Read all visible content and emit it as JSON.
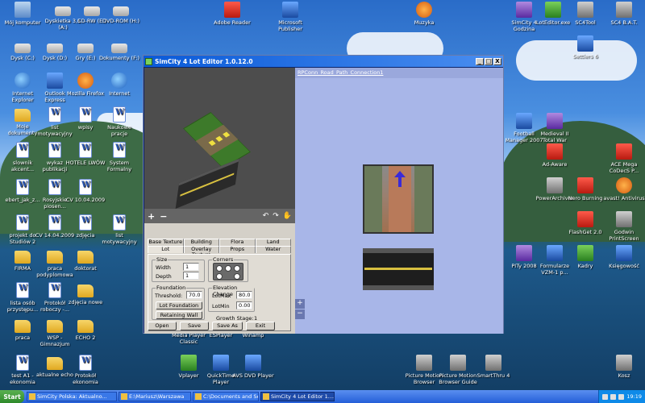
{
  "window": {
    "title": "SimCity 4 Lot Editor 1.0.12.0",
    "minimize": "_",
    "maximize": "□",
    "close": "X"
  },
  "viewport": {
    "lot_name": "RPConn_Road_Path_Connection1",
    "zoom_in": "+",
    "zoom_out": "−"
  },
  "toolstrip": {
    "add": "+",
    "remove": "−",
    "rotate_left": "↶",
    "rotate_right": "↷",
    "hand": "✋"
  },
  "tabs": {
    "row1": [
      "Base Texture",
      "Building",
      "Flora",
      "Land"
    ],
    "row2": [
      "Lot",
      "Overlay Texture",
      "Props",
      "Water"
    ],
    "active": "Lot"
  },
  "lot_tab": {
    "size_label": "Size",
    "width_label": "Width",
    "width_value": "1",
    "depth_label": "Depth",
    "depth_value": "1",
    "corners_label": "Corners",
    "foundation_label": "Foundation",
    "threshold_label": "Threshold:",
    "threshold_value": "70.0",
    "lot_foundation_button": "Lot Foundation",
    "retaining_wall_button": "Retaining Wall",
    "elevation_label": "Elevation Change",
    "lotmax_label": "LotMax",
    "lotmax_value": "80.0",
    "lotmin_label": "LotMin",
    "lotmin_value": "0.00",
    "growth_stage_label": "Growth Stage:",
    "growth_stage_value": "1"
  },
  "bottom_buttons": {
    "open": "Open",
    "save": "Save",
    "save_as": "Save As",
    "exit": "Exit"
  },
  "desktop_icons": [
    {
      "label": "Mój komputer",
      "kind": "pc"
    },
    {
      "label": "Dyskietka 3,5 (A:)",
      "kind": "drive"
    },
    {
      "label": "CD-RW (E:)",
      "kind": "drive"
    },
    {
      "label": "DVD-ROM (H:)",
      "kind": "drive"
    },
    {
      "label": "Adobe Reader",
      "kind": "red"
    },
    {
      "label": "Microsoft Publisher",
      "kind": "blue"
    },
    {
      "label": "Muzyka",
      "kind": "orange"
    },
    {
      "label": "SimCity 4 Godzina",
      "kind": "purple"
    },
    {
      "label": "LotEditor.exe",
      "kind": "green"
    },
    {
      "label": "SC4Tool",
      "kind": "gray"
    },
    {
      "label": "SC4 B.A.T.",
      "kind": "gray"
    },
    {
      "label": "Dysk (C:)",
      "kind": "drive"
    },
    {
      "label": "Dysk (D:)",
      "kind": "drive"
    },
    {
      "label": "Gry (E:)",
      "kind": "drive"
    },
    {
      "label": "Dokumenty (F:)",
      "kind": "drive"
    },
    {
      "label": "Internet Explorer",
      "kind": "globe"
    },
    {
      "label": "Outlook Express",
      "kind": "blue"
    },
    {
      "label": "Mozilla Firefox",
      "kind": "orange"
    },
    {
      "label": "Internet",
      "kind": "globe"
    },
    {
      "label": "Moje dokumenty",
      "kind": "folder"
    },
    {
      "label": "list motywacyjny",
      "kind": "doc"
    },
    {
      "label": "wpisy",
      "kind": "doc"
    },
    {
      "label": "Naukowe pracje",
      "kind": "doc"
    },
    {
      "label": "slownik akcent...",
      "kind": "doc"
    },
    {
      "label": "wykaz publikacji",
      "kind": "doc"
    },
    {
      "label": "HOTELE LWÓW",
      "kind": "doc"
    },
    {
      "label": "System Formalny",
      "kind": "doc"
    },
    {
      "label": "ebert_jak_z...",
      "kind": "doc"
    },
    {
      "label": "Rosyjskie piosen...",
      "kind": "doc"
    },
    {
      "label": "CV 10.04.2009",
      "kind": "doc"
    },
    {
      "label": "projekt do Studiów 2",
      "kind": "doc"
    },
    {
      "label": "CV 14.04.2009",
      "kind": "doc"
    },
    {
      "label": "zdjęcia",
      "kind": "doc"
    },
    {
      "label": "list motywacyjny",
      "kind": "doc"
    },
    {
      "label": "FIRMA",
      "kind": "folder"
    },
    {
      "label": "praca podyplomowa",
      "kind": "folder"
    },
    {
      "label": "doktorat",
      "kind": "folder"
    },
    {
      "label": "lista osób przystępu...",
      "kind": "doc"
    },
    {
      "label": "Protokół roboczy -...",
      "kind": "doc"
    },
    {
      "label": "zdjęcia nowe",
      "kind": "folder"
    },
    {
      "label": "praca",
      "kind": "folder"
    },
    {
      "label": "WSP - Gimnazjum",
      "kind": "folder"
    },
    {
      "label": "ECHO 2",
      "kind": "folder"
    },
    {
      "label": "test A1 - ekonomia",
      "kind": "doc"
    },
    {
      "label": "aktualne echo",
      "kind": "folder"
    },
    {
      "label": "Protokół ekonomia",
      "kind": "doc"
    },
    {
      "label": "Media Player Classic",
      "kind": "gray"
    },
    {
      "label": "ESPlayer",
      "kind": "gray"
    },
    {
      "label": "Winamp",
      "kind": "orange"
    },
    {
      "label": "Vplayer",
      "kind": "green"
    },
    {
      "label": "QuickTime Player",
      "kind": "blue"
    },
    {
      "label": "AVS DVD Player",
      "kind": "blue"
    },
    {
      "label": "Picture Motion Browser",
      "kind": "gray"
    },
    {
      "label": "Picture Motion Browser Guide",
      "kind": "gray"
    },
    {
      "label": "SmartThru 4",
      "kind": "gray"
    },
    {
      "label": "Kosz",
      "kind": "gray"
    },
    {
      "label": "Football Manager 2007",
      "kind": "blue"
    },
    {
      "label": "Medieval II Total War",
      "kind": "purple"
    },
    {
      "label": "Settlers 6",
      "kind": "blue"
    },
    {
      "label": "Ad-Aware",
      "kind": "red"
    },
    {
      "label": "ACE Mega CoDecS P...",
      "kind": "red"
    },
    {
      "label": "PowerArchiver",
      "kind": "gray"
    },
    {
      "label": "Nero Burning",
      "kind": "red"
    },
    {
      "label": "avast! Antivirus",
      "kind": "orange"
    },
    {
      "label": "FlashGet 2.0",
      "kind": "red"
    },
    {
      "label": "Godwin PrintScreen",
      "kind": "gray"
    },
    {
      "label": "PITy 2008",
      "kind": "purple"
    },
    {
      "label": "Formularze VZM-1 p...",
      "kind": "blue"
    },
    {
      "label": "Kadry",
      "kind": "green"
    },
    {
      "label": "Księgowość",
      "kind": "blue"
    }
  ],
  "taskbar": {
    "start": "Start",
    "tasks": [
      "SimCity Polska: Aktualno...",
      "E:\\Mariusz\\Warszawa",
      "C:\\Documents and Settin...",
      "SimCity 4 Lot Editor 1...."
    ],
    "active_index": 3,
    "clock": "19:19"
  }
}
